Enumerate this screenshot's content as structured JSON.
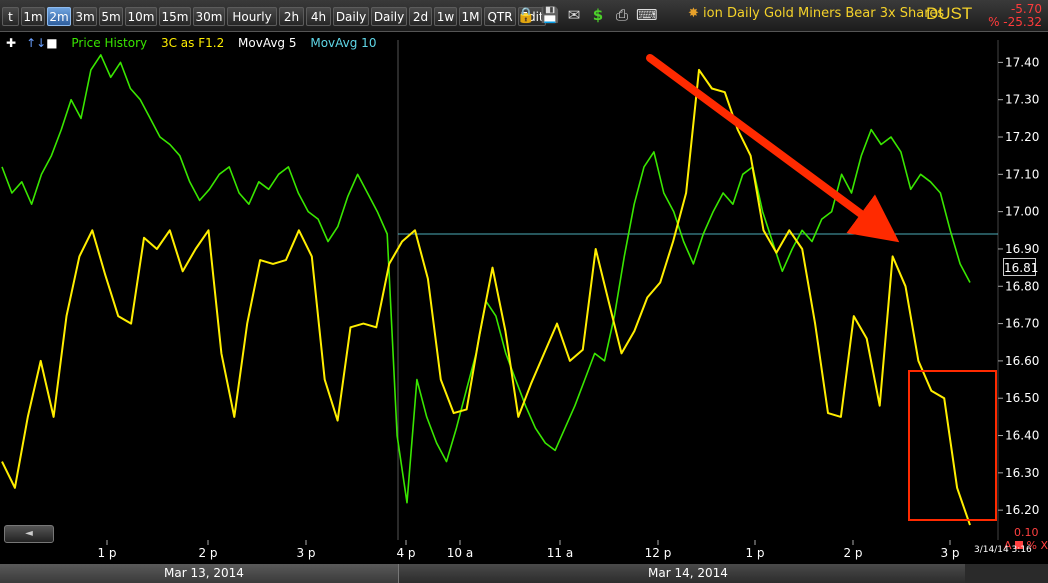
{
  "toolbar": {
    "timeframes": [
      "t",
      "1m",
      "2m",
      "3m",
      "5m",
      "10m",
      "15m",
      "30m",
      "Hourly",
      "2h",
      "4h",
      "Daily",
      "Daily",
      "2d",
      "1w",
      "1M",
      "QTR",
      "Edit"
    ],
    "active_timeframe": "2m",
    "icons": [
      "lock-icon",
      "save-icon",
      "mail-icon",
      "dollar-icon",
      "print-icon",
      "keyboard-icon"
    ]
  },
  "header": {
    "title": "ion Daily Gold Miners Bear 3x Shares",
    "ticker": "DUST",
    "change": "-5.70",
    "change_pct": "% -25.32"
  },
  "legend": {
    "price_history": "Price History",
    "indicator": "3C as F1.2",
    "ma5": "MovAvg 5",
    "ma10": "MovAvg 10"
  },
  "colors": {
    "price": "#39e600",
    "indicator": "#ffee00",
    "ma10": "#5fd7e8",
    "arrow": "#ff2a00",
    "box": "#ff2a00",
    "change": "#ff3b3b"
  },
  "last_price": "16.81",
  "scale_value": "0.10",
  "timestamp": "3/14/14 3:16",
  "bottom_dates": [
    "Mar 13, 2014",
    "Mar 14, 2014"
  ],
  "chart_data": {
    "type": "line",
    "y_ticks": [
      "17.40",
      "17.30",
      "17.20",
      "17.10",
      "17.00",
      "16.90",
      "16.80",
      "16.70",
      "16.60",
      "16.50",
      "16.40",
      "16.30",
      "16.20"
    ],
    "x_ticks": [
      "1 p",
      "2 p",
      "3 p",
      "4 p",
      "10 a",
      "11 a",
      "12 p",
      "1 p",
      "2 p",
      "3 p"
    ],
    "ylim": [
      16.12,
      17.46
    ],
    "reference_level": 16.94,
    "series": [
      {
        "name": "Price History",
        "values": [
          17.12,
          17.05,
          17.08,
          17.02,
          17.1,
          17.15,
          17.22,
          17.3,
          17.25,
          17.38,
          17.42,
          17.36,
          17.4,
          17.33,
          17.3,
          17.25,
          17.2,
          17.18,
          17.15,
          17.08,
          17.03,
          17.06,
          17.1,
          17.12,
          17.05,
          17.02,
          17.08,
          17.06,
          17.1,
          17.12,
          17.05,
          17.0,
          16.98,
          16.92,
          16.96,
          17.04,
          17.1,
          17.05,
          17.0,
          16.94,
          16.4,
          16.22,
          16.55,
          16.45,
          16.38,
          16.33,
          16.42,
          16.52,
          16.62,
          16.76,
          16.72,
          16.62,
          16.55,
          16.48,
          16.42,
          16.38,
          16.36,
          16.42,
          16.48,
          16.55,
          16.62,
          16.6,
          16.72,
          16.88,
          17.02,
          17.12,
          17.16,
          17.05,
          17.0,
          16.92,
          16.86,
          16.94,
          17.0,
          17.05,
          17.02,
          17.1,
          17.12,
          17.0,
          16.92,
          16.84,
          16.9,
          16.95,
          16.92,
          16.98,
          17.0,
          17.1,
          17.05,
          17.15,
          17.22,
          17.18,
          17.2,
          17.16,
          17.06,
          17.1,
          17.08,
          17.05,
          16.95,
          16.86,
          16.81
        ]
      },
      {
        "name": "3C as F1.2",
        "values": [
          16.33,
          16.26,
          16.45,
          16.6,
          16.45,
          16.72,
          16.88,
          16.95,
          16.83,
          16.72,
          16.7,
          16.93,
          16.9,
          16.95,
          16.84,
          16.9,
          16.95,
          16.62,
          16.45,
          16.7,
          16.87,
          16.86,
          16.87,
          16.95,
          16.88,
          16.55,
          16.44,
          16.69,
          16.7,
          16.69,
          16.86,
          16.92,
          16.95,
          16.82,
          16.55,
          16.46,
          16.47,
          16.67,
          16.85,
          16.68,
          16.45,
          16.54,
          16.62,
          16.7,
          16.6,
          16.63,
          16.9,
          16.76,
          16.62,
          16.68,
          16.77,
          16.81,
          16.92,
          17.05,
          17.38,
          17.33,
          17.32,
          17.22,
          17.15,
          16.95,
          16.89,
          16.95,
          16.9,
          16.7,
          16.46,
          16.45,
          16.72,
          16.66,
          16.48,
          16.88,
          16.8,
          16.6,
          16.52,
          16.5,
          16.26,
          16.16
        ]
      }
    ]
  }
}
